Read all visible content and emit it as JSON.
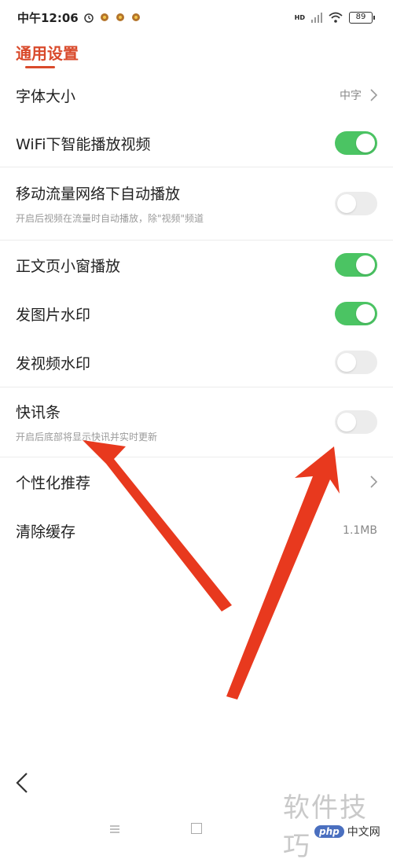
{
  "status_bar": {
    "time": "中午12:06",
    "network_label": "HD",
    "battery": "89",
    "icons": [
      "alarm-icon",
      "app-notification-icon",
      "signal-icon",
      "wifi-icon",
      "battery-icon"
    ]
  },
  "page": {
    "title": "通用设置",
    "accent_color": "#d94a2b"
  },
  "settings": [
    {
      "label": "字体大小",
      "value": "中字",
      "type": "link"
    },
    {
      "label": "WiFi下智能播放视频",
      "type": "toggle",
      "state": "on"
    },
    {
      "label": "移动流量网络下自动播放",
      "subtitle": "开启后视频在流量时自动播放，除\"视频\"频道",
      "type": "toggle",
      "state": "off"
    },
    {
      "label": "正文页小窗播放",
      "type": "toggle",
      "state": "on"
    },
    {
      "label": "发图片水印",
      "type": "toggle",
      "state": "on"
    },
    {
      "label": "发视频水印",
      "type": "toggle",
      "state": "off"
    },
    {
      "label": "快讯条",
      "subtitle": "开启后底部将显示快讯并实时更新",
      "type": "toggle",
      "state": "off"
    },
    {
      "label": "个性化推荐",
      "type": "link"
    },
    {
      "label": "清除缓存",
      "value": "1.1MB",
      "type": "info"
    }
  ],
  "colors": {
    "toggle_on": "#4bc463",
    "toggle_off": "#ececec",
    "arrow": "#e8391e"
  },
  "watermark": {
    "text": "软件技巧",
    "badge": "php",
    "badge_suffix": "中文网"
  }
}
